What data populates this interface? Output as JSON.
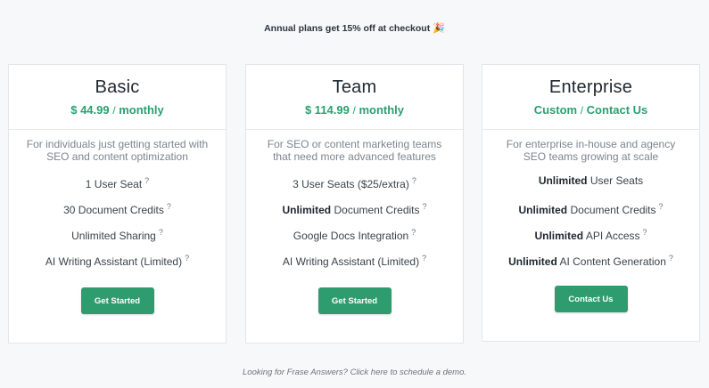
{
  "banner": {
    "text": "Annual plans get 15% off at checkout",
    "emoji": "🎉"
  },
  "plans": [
    {
      "name": "Basic",
      "price": "$ 44.99",
      "price_sep": "/",
      "period": "monthly",
      "description": "For individuals just getting started with SEO and content optimization",
      "features": [
        {
          "bold": "",
          "text": "1 User Seat"
        },
        {
          "bold": "",
          "text": "30 Document Credits"
        },
        {
          "bold": "",
          "text": "Unlimited Sharing"
        },
        {
          "bold": "",
          "text": "AI Writing Assistant (Limited)"
        }
      ],
      "button": "Get Started"
    },
    {
      "name": "Team",
      "price": "$ 114.99",
      "price_sep": "/",
      "period": "monthly",
      "description": "For SEO or content marketing teams that need more advanced features",
      "features": [
        {
          "bold": "",
          "text": "3 User Seats ($25/extra)"
        },
        {
          "bold": "Unlimited",
          "text": " Document Credits"
        },
        {
          "bold": "",
          "text": "Google Docs Integration"
        },
        {
          "bold": "",
          "text": "AI Writing Assistant (Limited)"
        }
      ],
      "button": "Get Started"
    },
    {
      "name": "Enterprise",
      "price": "Custom",
      "price_sep": "/",
      "period": "Contact Us",
      "description": "For enterprise in-house and agency SEO teams growing at scale",
      "features": [
        {
          "bold": "Unlimited",
          "text": " User Seats"
        },
        {
          "bold": "Unlimited",
          "text": " Document Credits"
        },
        {
          "bold": "Unlimited",
          "text": " API Access"
        },
        {
          "bold": "Unlimited",
          "text": " AI Content Generation"
        }
      ],
      "button": "Contact Us"
    }
  ],
  "help_mark": "?",
  "footer": "Looking for Frase Answers? Click here to schedule a demo."
}
